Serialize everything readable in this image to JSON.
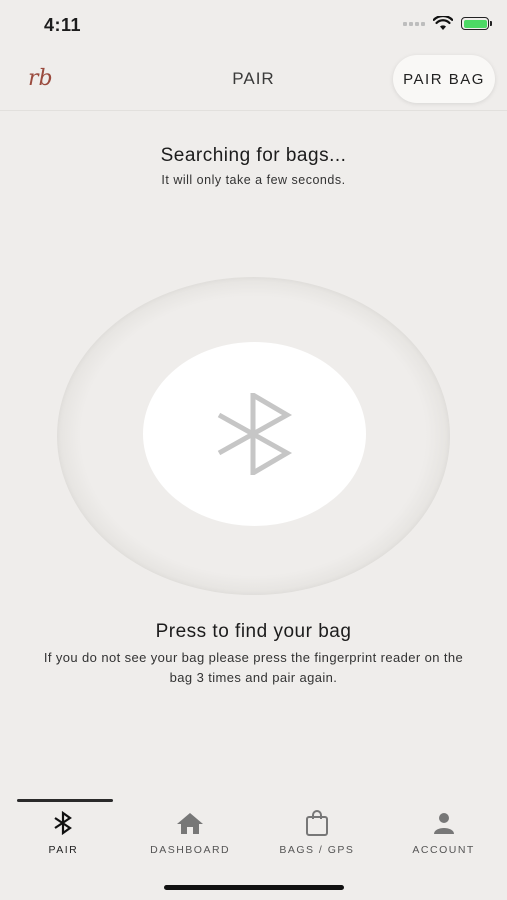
{
  "status_bar": {
    "time": "4:11"
  },
  "header": {
    "logo": "rb",
    "title": "PAIR",
    "pair_bag_label": "PAIR BAG"
  },
  "search": {
    "title": "Searching for bags...",
    "subtitle": "It will only take a few seconds."
  },
  "find": {
    "title": "Press to find your bag",
    "subtitle": "If you do not see your bag please press the fingerprint reader on the bag 3 times and pair again."
  },
  "tabs": [
    {
      "label": "PAIR",
      "icon": "bluetooth-icon",
      "active": true
    },
    {
      "label": "DASHBOARD",
      "icon": "home-icon",
      "active": false
    },
    {
      "label": "BAGS / GPS",
      "icon": "bag-icon",
      "active": false
    },
    {
      "label": "ACCOUNT",
      "icon": "person-icon",
      "active": false
    }
  ],
  "colors": {
    "background": "#efedeb",
    "logo": "#9a4a3d",
    "battery": "#4cd964",
    "bluetooth_glyph": "#c6c6c6"
  }
}
